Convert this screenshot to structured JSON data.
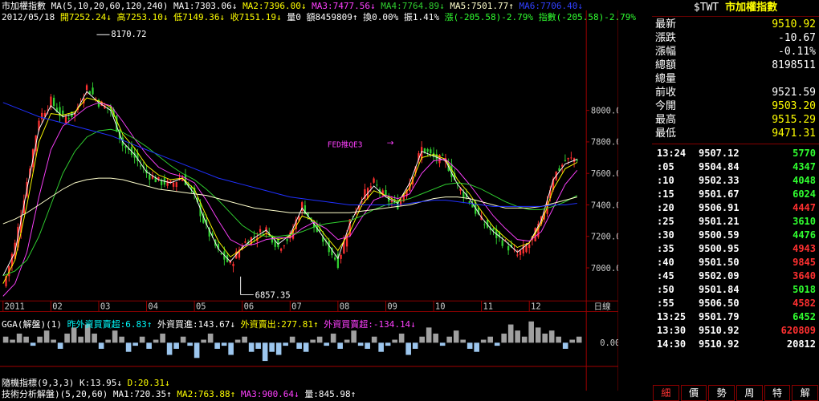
{
  "header": {
    "index_name": "市加權指數",
    "ma_params": "MA(5,10,20,60,120,240)",
    "ma1": "MA1:7303.06↓",
    "ma2": "MA2:7396.00↓",
    "ma3": "MA3:7477.56↓",
    "ma4": "MA4:7764.89↓",
    "ma5": "MA5:7501.77↑",
    "ma6": "MA6:7706.40↓",
    "date": "2012/05/18",
    "open": "開7252.24↓",
    "high": "高7253.10↓",
    "low": "低7149.36↓",
    "close": "收7151.19↓",
    "vol": "量0",
    "amount": "額8459809↑",
    "turnover": "換0.00%",
    "amplitude": "振1.41%",
    "change": "漲(-205.58)-2.79%",
    "index_change": "指數(-205.58)-2.79%"
  },
  "colors": {
    "bg": "#000000",
    "up": "#ff3030",
    "down": "#30d030",
    "ma1": "#ffffff",
    "ma2": "#ffff00",
    "ma3": "#ff40ff",
    "ma4": "#30d030",
    "ma5": "#ffffcc",
    "ma6": "#2030ff",
    "axis": "#a00000",
    "cyan": "#00ffff"
  },
  "chart_data": [
    {
      "type": "candlestick",
      "ylim": [
        6800,
        8500
      ],
      "yticks": [
        "8000.0",
        "7800.0",
        "7600.0",
        "7400.0",
        "7200.0",
        "7000.0"
      ],
      "ytick_values": [
        8000,
        7800,
        7600,
        7400,
        7200,
        7000
      ],
      "x_month_labels": [
        "2011",
        "02",
        "03",
        "04",
        "05",
        "06",
        "07",
        "08",
        "09",
        "10",
        "11",
        "12"
      ],
      "x_unit_label": "日線",
      "annotations": {
        "max_label": "8170.72",
        "min_label": "6857.35",
        "event_label": "FED推QE3",
        "event_arrow": "→"
      },
      "close_points": [
        [
          0,
          6880
        ],
        [
          4,
          7150
        ],
        [
          8,
          7550
        ],
        [
          12,
          7950
        ],
        [
          16,
          8060
        ],
        [
          20,
          7950
        ],
        [
          24,
          7980
        ],
        [
          28,
          8150
        ],
        [
          32,
          8050
        ],
        [
          36,
          8000
        ],
        [
          40,
          7780
        ],
        [
          44,
          7700
        ],
        [
          48,
          7600
        ],
        [
          52,
          7550
        ],
        [
          56,
          7530
        ],
        [
          60,
          7580
        ],
        [
          64,
          7450
        ],
        [
          68,
          7250
        ],
        [
          72,
          7100
        ],
        [
          76,
          7020
        ],
        [
          80,
          7150
        ],
        [
          84,
          7200
        ],
        [
          88,
          7250
        ],
        [
          92,
          7130
        ],
        [
          96,
          7200
        ],
        [
          100,
          7400
        ],
        [
          104,
          7260
        ],
        [
          108,
          7150
        ],
        [
          112,
          7030
        ],
        [
          116,
          7300
        ],
        [
          120,
          7450
        ],
        [
          124,
          7540
        ],
        [
          128,
          7440
        ],
        [
          132,
          7400
        ],
        [
          136,
          7550
        ],
        [
          140,
          7760
        ],
        [
          144,
          7700
        ],
        [
          148,
          7680
        ],
        [
          152,
          7520
        ],
        [
          156,
          7420
        ],
        [
          160,
          7300
        ],
        [
          164,
          7220
        ],
        [
          168,
          7150
        ],
        [
          172,
          7080
        ],
        [
          176,
          7150
        ],
        [
          180,
          7300
        ],
        [
          184,
          7580
        ],
        [
          188,
          7680
        ],
        [
          192,
          7700
        ]
      ],
      "series": [
        {
          "name": "MA1",
          "values": [
            6950,
            7100,
            7500,
            7880,
            8030,
            7960,
            7980,
            8120,
            8050,
            8000,
            7800,
            7720,
            7610,
            7560,
            7540,
            7570,
            7470,
            7280,
            7120,
            7040,
            7130,
            7190,
            7240,
            7150,
            7210,
            7380,
            7280,
            7170,
            7060,
            7280,
            7430,
            7520,
            7450,
            7410,
            7540,
            7740,
            7710,
            7680,
            7530,
            7440,
            7320,
            7230,
            7170,
            7100,
            7160,
            7300,
            7560,
            7660,
            7690
          ]
        },
        {
          "name": "MA2",
          "values": [
            6900,
            7050,
            7400,
            7800,
            7980,
            7970,
            7990,
            8080,
            8060,
            8020,
            7850,
            7760,
            7650,
            7590,
            7560,
            7570,
            7500,
            7330,
            7170,
            7070,
            7120,
            7170,
            7220,
            7180,
            7200,
            7330,
            7300,
            7200,
            7110,
            7230,
            7400,
            7490,
            7460,
            7420,
            7510,
            7700,
            7720,
            7690,
            7560,
            7470,
            7360,
            7260,
            7190,
            7130,
            7160,
            7280,
            7500,
            7630,
            7670
          ]
        },
        {
          "name": "MA3",
          "values": [
            6820,
            6900,
            7100,
            7450,
            7750,
            7900,
            7960,
            8020,
            8050,
            8030,
            7930,
            7820,
            7720,
            7640,
            7600,
            7580,
            7540,
            7430,
            7300,
            7180,
            7140,
            7150,
            7180,
            7190,
            7190,
            7250,
            7290,
            7250,
            7180,
            7200,
            7320,
            7430,
            7460,
            7440,
            7470,
            7600,
            7680,
            7690,
            7620,
            7530,
            7430,
            7330,
            7250,
            7180,
            7170,
            7230,
            7380,
            7530,
            7620
          ]
        },
        {
          "name": "MA4",
          "values": [
            6950,
            6980,
            7050,
            7200,
            7400,
            7600,
            7740,
            7830,
            7870,
            7880,
            7860,
            7820,
            7770,
            7710,
            7650,
            7600,
            7560,
            7500,
            7430,
            7350,
            7270,
            7220,
            7200,
            7200,
            7210,
            7230,
            7260,
            7280,
            7290,
            7300,
            7330,
            7370,
            7400,
            7420,
            7440,
            7470,
            7500,
            7530,
            7540,
            7530,
            7500,
            7460,
            7420,
            7390,
            7370,
            7370,
            7390,
            7420,
            7460
          ]
        },
        {
          "name": "MA5",
          "values": [
            7280,
            7310,
            7350,
            7400,
            7450,
            7500,
            7540,
            7560,
            7570,
            7570,
            7560,
            7540,
            7520,
            7500,
            7490,
            7480,
            7470,
            7460,
            7440,
            7420,
            7400,
            7380,
            7370,
            7360,
            7350,
            7350,
            7350,
            7350,
            7350,
            7350,
            7360,
            7370,
            7380,
            7390,
            7400,
            7420,
            7440,
            7450,
            7450,
            7440,
            7420,
            7400,
            7380,
            7380,
            7380,
            7390,
            7410,
            7430,
            7450
          ]
        },
        {
          "name": "MA6",
          "values": [
            8050,
            8020,
            7990,
            7960,
            7940,
            7920,
            7900,
            7880,
            7860,
            7840,
            7810,
            7780,
            7750,
            7720,
            7690,
            7660,
            7630,
            7600,
            7570,
            7550,
            7530,
            7510,
            7490,
            7470,
            7450,
            7440,
            7430,
            7420,
            7410,
            7400,
            7400,
            7400,
            7400,
            7400,
            7410,
            7420,
            7430,
            7430,
            7420,
            7410,
            7400,
            7390,
            7390,
            7390,
            7390,
            7390,
            7400,
            7400,
            7410
          ]
        }
      ]
    },
    {
      "type": "bar",
      "title": "GGA(解盤)(1)",
      "series_labels": [
        "昨外資買賣超:6.83↑",
        "外資買進:143.67↓",
        "外資賣出:277.81↑",
        "外資買賣超:-134.14↓"
      ],
      "ytick": "0.00",
      "values": [
        2,
        1,
        3,
        2,
        -1,
        2,
        4,
        1,
        -2,
        3,
        5,
        2,
        6,
        3,
        -2,
        1,
        4,
        2,
        -3,
        -1,
        2,
        -2,
        1,
        3,
        -4,
        -2,
        2,
        -1,
        -5,
        1,
        3,
        -2,
        -1,
        -4,
        1,
        2,
        -3,
        -2,
        -6,
        -3,
        -4,
        -1,
        2,
        -2,
        -3,
        1,
        2,
        -1,
        3,
        -2,
        1,
        4,
        -1,
        -2,
        2,
        -3,
        -1,
        1,
        3,
        -4,
        -2,
        2,
        5,
        3,
        -1,
        2,
        4,
        1,
        -2,
        -3,
        1,
        2,
        -1,
        3,
        6,
        4,
        2,
        7,
        5,
        3,
        4,
        2,
        -2,
        1,
        2
      ]
    }
  ],
  "indicator1": {
    "title": "隨機指標(9,3,3)",
    "k": "K:13.95↓",
    "d": "D:20.31↓"
  },
  "indicator2": {
    "title": "技術分析解盤)(5,20,60)",
    "ma1": "MA1:720.35↑",
    "ma2": "MA2:763.88↑",
    "ma3": "MA3:900.64↓",
    "vol": "量:845.98↑"
  },
  "right_panel": {
    "symbol": "$TWT",
    "name": "市加權指數",
    "quotes": [
      {
        "label": "最新",
        "value": "9510.92",
        "color": "#ffff00"
      },
      {
        "label": "漲跌",
        "value": "-10.67",
        "color": "#ffffff"
      },
      {
        "label": "漲幅",
        "value": "-0.11%",
        "color": "#ffffff"
      },
      {
        "label": "總額",
        "value": "8198511",
        "color": "#ffffff"
      },
      {
        "label": "總量",
        "value": "",
        "color": "#ffffff"
      },
      {
        "label": "前收",
        "value": "9521.59",
        "color": "#ffffff"
      },
      {
        "label": "今開",
        "value": "9503.20",
        "color": "#ffff00"
      },
      {
        "label": "最高",
        "value": "9515.29",
        "color": "#ffff00"
      },
      {
        "label": "最低",
        "value": "9471.31",
        "color": "#ffff00"
      }
    ],
    "ticks": [
      {
        "time": "13:24",
        "price": "9507.12",
        "vol": "5770",
        "vcolor": "#30ff30"
      },
      {
        "time": ":05",
        "price": "9504.84",
        "vol": "4347",
        "vcolor": "#30ff30"
      },
      {
        "time": ":10",
        "price": "9502.33",
        "vol": "4048",
        "vcolor": "#30ff30"
      },
      {
        "time": ":15",
        "price": "9501.67",
        "vol": "6024",
        "vcolor": "#30ff30"
      },
      {
        "time": ":20",
        "price": "9506.91",
        "vol": "4447",
        "vcolor": "#ff3030"
      },
      {
        "time": ":25",
        "price": "9501.21",
        "vol": "3610",
        "vcolor": "#30ff30"
      },
      {
        "time": ":30",
        "price": "9500.59",
        "vol": "4476",
        "vcolor": "#30ff30"
      },
      {
        "time": ":35",
        "price": "9500.95",
        "vol": "4943",
        "vcolor": "#ff3030"
      },
      {
        "time": ":40",
        "price": "9501.50",
        "vol": "9845",
        "vcolor": "#ff3030"
      },
      {
        "time": ":45",
        "price": "9502.09",
        "vol": "3640",
        "vcolor": "#ff3030"
      },
      {
        "time": ":50",
        "price": "9501.84",
        "vol": "5018",
        "vcolor": "#30ff30"
      },
      {
        "time": ":55",
        "price": "9506.50",
        "vol": "4582",
        "vcolor": "#ff3030"
      },
      {
        "time": "13:25",
        "price": "9501.79",
        "vol": "6452",
        "vcolor": "#30ff30"
      },
      {
        "time": "13:30",
        "price": "9510.92",
        "vol": "620809",
        "vcolor": "#ff3030"
      },
      {
        "time": "14:30",
        "price": "9510.92",
        "vol": "20812",
        "vcolor": "#ffffff"
      }
    ],
    "tabs": [
      "細",
      "價",
      "勢",
      "周",
      "特",
      "解"
    ]
  }
}
